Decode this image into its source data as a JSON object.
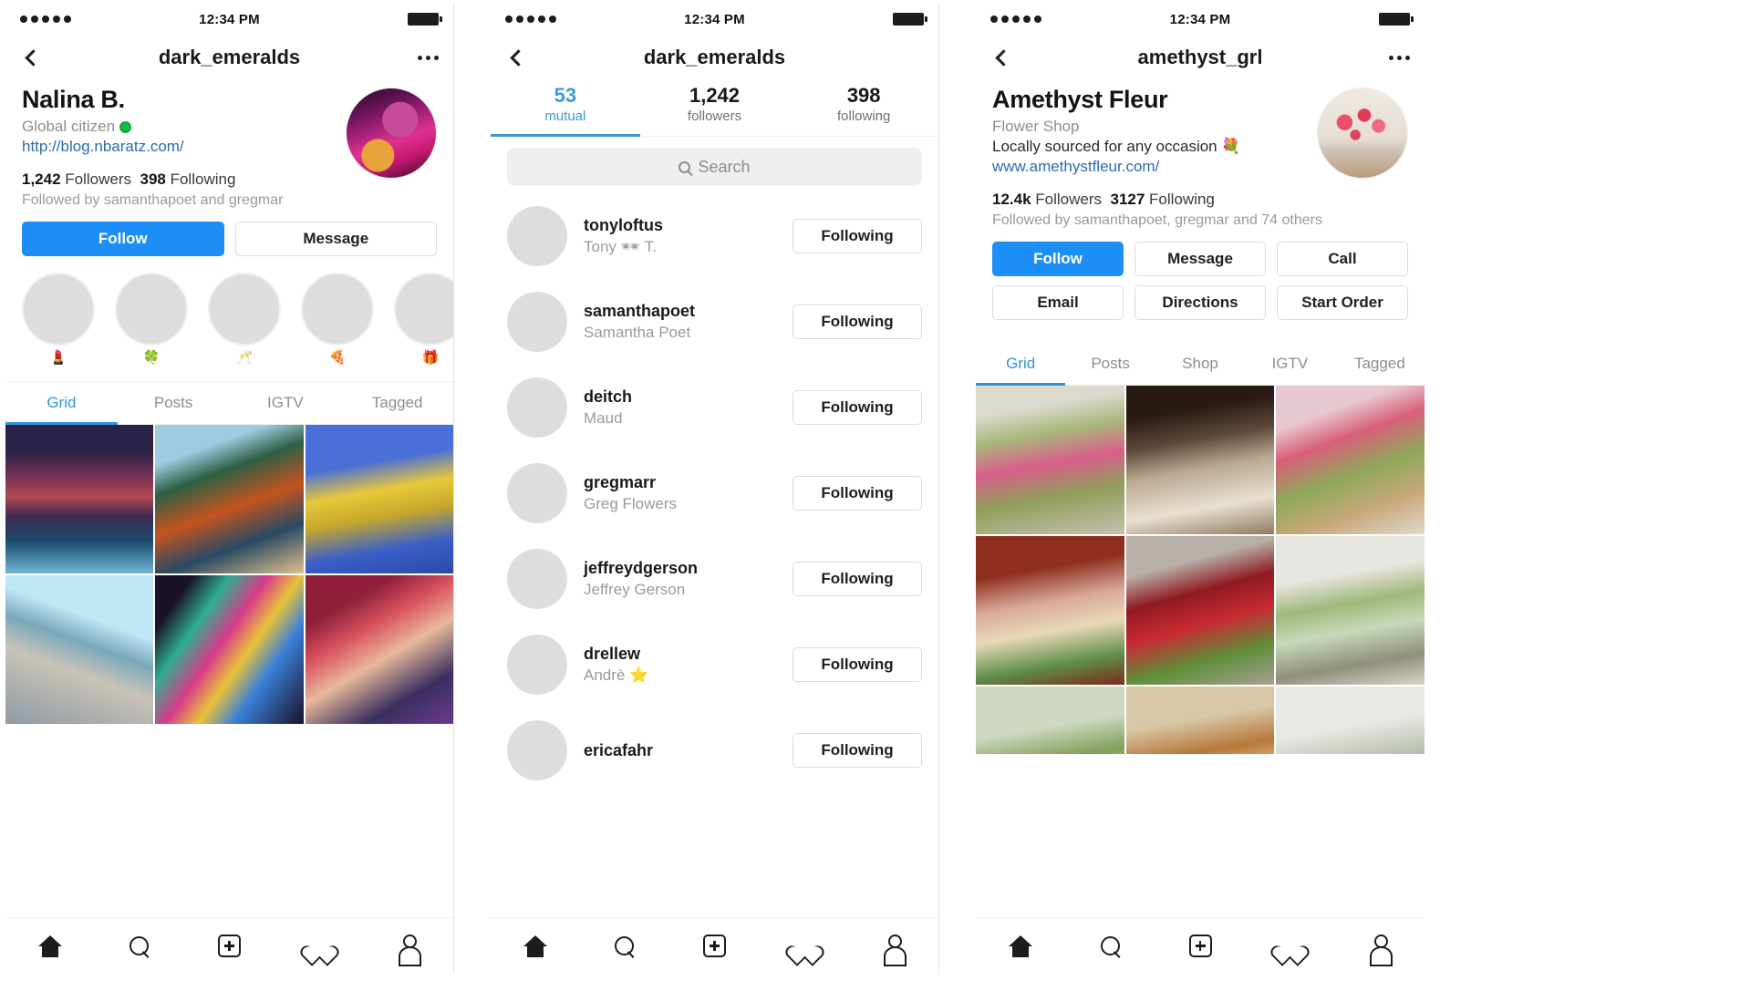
{
  "statusbar": {
    "time": "12:34 PM",
    "signal_dots": 5
  },
  "panel1": {
    "nav": {
      "title": "dark_emeralds",
      "back_icon": "chevron-left-icon",
      "more_icon": "ellipsis-icon"
    },
    "profile": {
      "display_name": "Nalina B.",
      "category": "Global citizen",
      "verified_dot": "#12bb4a",
      "website": "http://blog.nbaratz.com/",
      "followers_count": "1,242",
      "followers_label": "Followers",
      "following_count": "398",
      "following_label": "Following",
      "followed_by": "Followed by samanthapoet and gregmar"
    },
    "actions": [
      {
        "label": "Follow",
        "style": "primary"
      },
      {
        "label": "Message",
        "style": "secondary"
      }
    ],
    "highlights": [
      {
        "label": "💄"
      },
      {
        "label": "🍀"
      },
      {
        "label": "🥂"
      },
      {
        "label": "🍕"
      },
      {
        "label": "🎁"
      }
    ],
    "tabs": [
      {
        "label": "Grid",
        "active": true
      },
      {
        "label": "Posts",
        "active": false
      },
      {
        "label": "IGTV",
        "active": false
      },
      {
        "label": "Tagged",
        "active": false
      }
    ]
  },
  "panel2": {
    "nav": {
      "title": "dark_emeralds",
      "back_icon": "chevron-left-icon"
    },
    "counts": [
      {
        "number": "53",
        "label": "mutual",
        "active": true
      },
      {
        "number": "1,242",
        "label": "followers",
        "active": false
      },
      {
        "number": "398",
        "label": "following",
        "active": false
      }
    ],
    "search": {
      "placeholder": "Search",
      "value": "",
      "icon": "search-icon"
    },
    "followers": [
      {
        "username": "tonyloftus",
        "fullname": "Tony 🕶 T.",
        "button": "Following"
      },
      {
        "username": "samanthapoet",
        "fullname": "Samantha Poet",
        "button": "Following"
      },
      {
        "username": "deitch",
        "fullname": "Maud",
        "button": "Following"
      },
      {
        "username": "gregmarr",
        "fullname": "Greg Flowers",
        "button": "Following"
      },
      {
        "username": "jeffreydgerson",
        "fullname": "Jeffrey Gerson",
        "button": "Following"
      },
      {
        "username": "drellew",
        "fullname": "Andrè ⭐",
        "button": "Following"
      },
      {
        "username": "ericafahr",
        "fullname": "",
        "button": "Following"
      }
    ]
  },
  "panel3": {
    "nav": {
      "title": "amethyst_grl",
      "back_icon": "chevron-left-icon",
      "more_icon": "ellipsis-icon"
    },
    "profile": {
      "display_name": "Amethyst Fleur",
      "category": "Flower Shop",
      "bio": "Locally sourced for any occasion 💐",
      "website": "www.amethystfleur.com/",
      "followers_count": "12.4k",
      "followers_label": "Followers",
      "following_count": "3127",
      "following_label": "Following",
      "followed_by": "Followed by samanthapoet, gregmar and 74 others"
    },
    "actions_row1": [
      {
        "label": "Follow",
        "style": "primary"
      },
      {
        "label": "Message",
        "style": "secondary"
      },
      {
        "label": "Call",
        "style": "secondary"
      }
    ],
    "actions_row2": [
      {
        "label": "Email",
        "style": "secondary"
      },
      {
        "label": "Directions",
        "style": "secondary"
      },
      {
        "label": "Start Order",
        "style": "secondary"
      }
    ],
    "tabs": [
      {
        "label": "Grid",
        "active": true
      },
      {
        "label": "Posts",
        "active": false
      },
      {
        "label": "Shop",
        "active": false
      },
      {
        "label": "IGTV",
        "active": false
      },
      {
        "label": "Tagged",
        "active": false
      }
    ]
  },
  "bottomnav": [
    {
      "icon": "home-icon",
      "name": "home"
    },
    {
      "icon": "search-icon",
      "name": "search"
    },
    {
      "icon": "add-post-icon",
      "name": "add"
    },
    {
      "icon": "heart-icon",
      "name": "activity"
    },
    {
      "icon": "person-icon",
      "name": "profile"
    }
  ],
  "colors": {
    "accent_blue": "#1c8ef5",
    "tab_blue": "#2f93d8",
    "link_blue": "#2a6bb5",
    "muted": "#8e8e8e"
  }
}
